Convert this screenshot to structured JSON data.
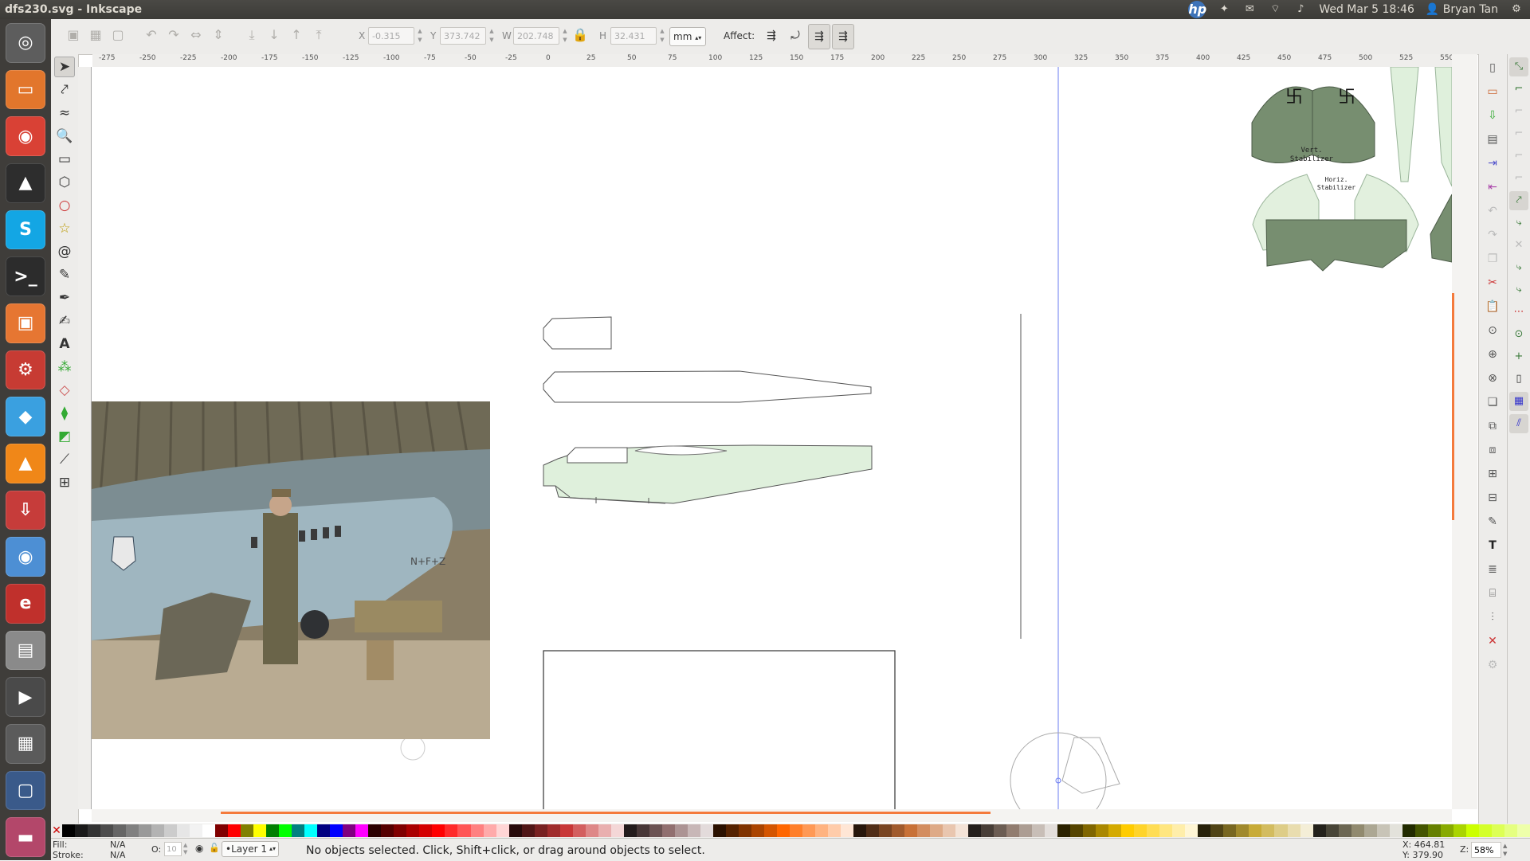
{
  "window": {
    "title": "dfs230.svg - Inkscape"
  },
  "top_panel": {
    "hp_logo": "hp",
    "clock": "Wed Mar  5 18:46",
    "user": "Bryan Tan",
    "indicators": [
      "dropbox-icon",
      "mail-icon",
      "wifi-icon",
      "volume-icon"
    ]
  },
  "launcher": {
    "items": [
      {
        "name": "dash-home",
        "glyph": "◎",
        "color": "#5d5d5d"
      },
      {
        "name": "files",
        "glyph": "▭",
        "color": "#e2762c"
      },
      {
        "name": "chrome",
        "glyph": "◉",
        "color": "#d94135"
      },
      {
        "name": "inkscape",
        "glyph": "▲",
        "color": "#2d2d2d"
      },
      {
        "name": "skype",
        "glyph": "S",
        "color": "#13a6e4"
      },
      {
        "name": "terminal",
        "glyph": ">_",
        "color": "#2c2c2c"
      },
      {
        "name": "software-center",
        "glyph": "▣",
        "color": "#e67632"
      },
      {
        "name": "system-settings",
        "glyph": "⚙",
        "color": "#c73b33"
      },
      {
        "name": "dropbox",
        "glyph": "◆",
        "color": "#3aa0e0"
      },
      {
        "name": "vlc",
        "glyph": "▲",
        "color": "#f08718"
      },
      {
        "name": "update-manager",
        "glyph": "⇩",
        "color": "#c63c3a"
      },
      {
        "name": "chromium",
        "glyph": "◉",
        "color": "#4d8fd4"
      },
      {
        "name": "ebook-reader",
        "glyph": "e",
        "color": "#c0302c"
      },
      {
        "name": "printer",
        "glyph": "▤",
        "color": "#8a8a8a"
      },
      {
        "name": "video-editor",
        "glyph": "▶",
        "color": "#4a4a4a"
      },
      {
        "name": "calculator",
        "glyph": "▦",
        "color": "#5b5b5b"
      },
      {
        "name": "workspace-switcher",
        "glyph": "▢",
        "color": "#3a5a8a"
      },
      {
        "name": "trash",
        "glyph": "▬",
        "color": "#b3476a"
      }
    ]
  },
  "toolbar": {
    "x_label": "X",
    "x_value": "-0.315",
    "y_label": "Y",
    "y_value": "373.742",
    "w_label": "W",
    "w_value": "202.748",
    "h_label": "H",
    "h_value": "32.431",
    "unit": "mm",
    "affect_label": "Affect:"
  },
  "ruler": {
    "h_ticks": [
      "-275",
      "-250",
      "-225",
      "-200",
      "-175",
      "-150",
      "-125",
      "-100",
      "-75",
      "-50",
      "-25",
      "0",
      "25",
      "50",
      "75",
      "100",
      "125",
      "150",
      "175",
      "200",
      "225",
      "250",
      "275",
      "300",
      "325",
      "350",
      "375",
      "400",
      "425",
      "450",
      "475",
      "500",
      "525",
      "550"
    ]
  },
  "canvas": {
    "vert_stabilizer_label_1": "Vert.",
    "vert_stabilizer_label_2": "Stabilizer",
    "horiz_stabilizer_label_1": "Horiz.",
    "horiz_stabilizer_label_2": "Stabilizer",
    "photo_plane_marking": "N+F+Z"
  },
  "palette": {
    "colors": [
      "#000000",
      "#1a1a1a",
      "#333333",
      "#4d4d4d",
      "#666666",
      "#808080",
      "#999999",
      "#b3b3b3",
      "#cccccc",
      "#e6e6e6",
      "#f2f2f2",
      "#ffffff",
      "#800000",
      "#ff0000",
      "#808000",
      "#ffff00",
      "#008000",
      "#00ff00",
      "#008080",
      "#00ffff",
      "#000080",
      "#0000ff",
      "#800080",
      "#ff00ff",
      "#2b0000",
      "#550000",
      "#800000",
      "#aa0000",
      "#d40000",
      "#ff0000",
      "#ff2a2a",
      "#ff5555",
      "#ff8080",
      "#ffaaaa",
      "#ffd5d5",
      "#280b0b",
      "#501616",
      "#782121",
      "#a02c2c",
      "#c83737",
      "#d35f5f",
      "#de8787",
      "#e9afaf",
      "#f4d7d7",
      "#241c1c",
      "#483737",
      "#6c5353",
      "#916f6f",
      "#ac9393",
      "#c8b7b7",
      "#e3dbdb",
      "#2b1100",
      "#552200",
      "#803300",
      "#aa4400",
      "#d45500",
      "#ff6600",
      "#ff7f2a",
      "#ff9955",
      "#ffb380",
      "#ffccaa",
      "#ffe6d5",
      "#28170b",
      "#502d16",
      "#784421",
      "#a05a2c",
      "#c87137",
      "#d38d5f",
      "#deaa87",
      "#e9c6af",
      "#f4e3d7",
      "#241f1c",
      "#483e37",
      "#6c5d53",
      "#917c6f",
      "#ac9d93",
      "#c8beb7",
      "#e3dedb",
      "#2b2200",
      "#554400",
      "#806600",
      "#aa8800",
      "#d4aa00",
      "#ffcc00",
      "#ffd42a",
      "#ffdd55",
      "#ffe680",
      "#ffeeaa",
      "#fff6d5",
      "#28220b",
      "#504416",
      "#786721",
      "#a0892c",
      "#c8ab37",
      "#d3bc5f",
      "#decd87",
      "#e9ddaf",
      "#f4eed7",
      "#24221c",
      "#484537",
      "#6c6753",
      "#918a6f",
      "#aca793",
      "#c8c4b7",
      "#e3e2db",
      "#222b00",
      "#445500",
      "#668000",
      "#88aa00",
      "#aad400",
      "#ccff00",
      "#d4ff2a",
      "#ddff55",
      "#e5ff80",
      "#eeffaa"
    ]
  },
  "status": {
    "fill_label": "Fill:",
    "fill_value": "N/A",
    "stroke_label": "Stroke:",
    "stroke_value": "N/A",
    "opacity_label": "O:",
    "opacity_value": "10",
    "layer": "•Layer 1",
    "message": "No objects selected. Click, Shift+click, or drag around objects to select.",
    "x_coord": "X:  464.81",
    "y_coord": "Y:  379.90",
    "zoom_label": "Z:",
    "zoom_value": "58%"
  }
}
